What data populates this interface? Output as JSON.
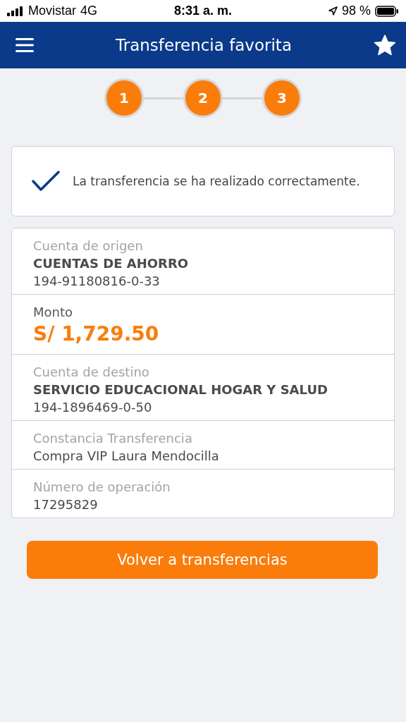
{
  "status_bar": {
    "carrier": "Movistar",
    "network": "4G",
    "time": "8:31 a. m.",
    "battery": "98 %"
  },
  "header": {
    "title": "Transferencia favorita"
  },
  "steps": [
    "1",
    "2",
    "3"
  ],
  "success": {
    "message": "La transferencia se ha realizado correctamente."
  },
  "details": [
    {
      "kind": "account",
      "label": "Cuenta de origen",
      "name": "CUENTAS DE AHORRO",
      "number": "194-91180816-0-33"
    },
    {
      "kind": "amount",
      "label": "Monto",
      "value": "S/ 1,729.50"
    },
    {
      "kind": "account",
      "label": "Cuenta de destino",
      "name": "SERVICIO EDUCACIONAL HOGAR Y SALUD",
      "number": "194-1896469-0-50"
    },
    {
      "kind": "text",
      "label": "Constancia Transferencia",
      "value": "Compra VIP Laura Mendocilla"
    },
    {
      "kind": "text",
      "label": "Número de operación",
      "value": "17295829"
    }
  ],
  "button": "Volver a transferencias"
}
